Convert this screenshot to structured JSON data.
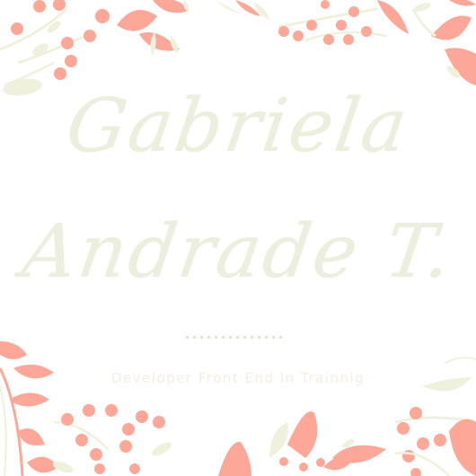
{
  "name": {
    "first": "Gabriela",
    "last": "Andrade T."
  },
  "subtitle": "Developer Front End In Trainnig",
  "palette": {
    "coral": "#fca797",
    "leaf_cream": "#eff1dc",
    "text_cream": "#ecefde",
    "background": "#ffffff"
  },
  "decorations": [
    "floral-corner-top-left",
    "floral-corner-top-right",
    "floral-corner-bottom-left",
    "floral-corner-bottom-right",
    "floral-bottom-center"
  ]
}
